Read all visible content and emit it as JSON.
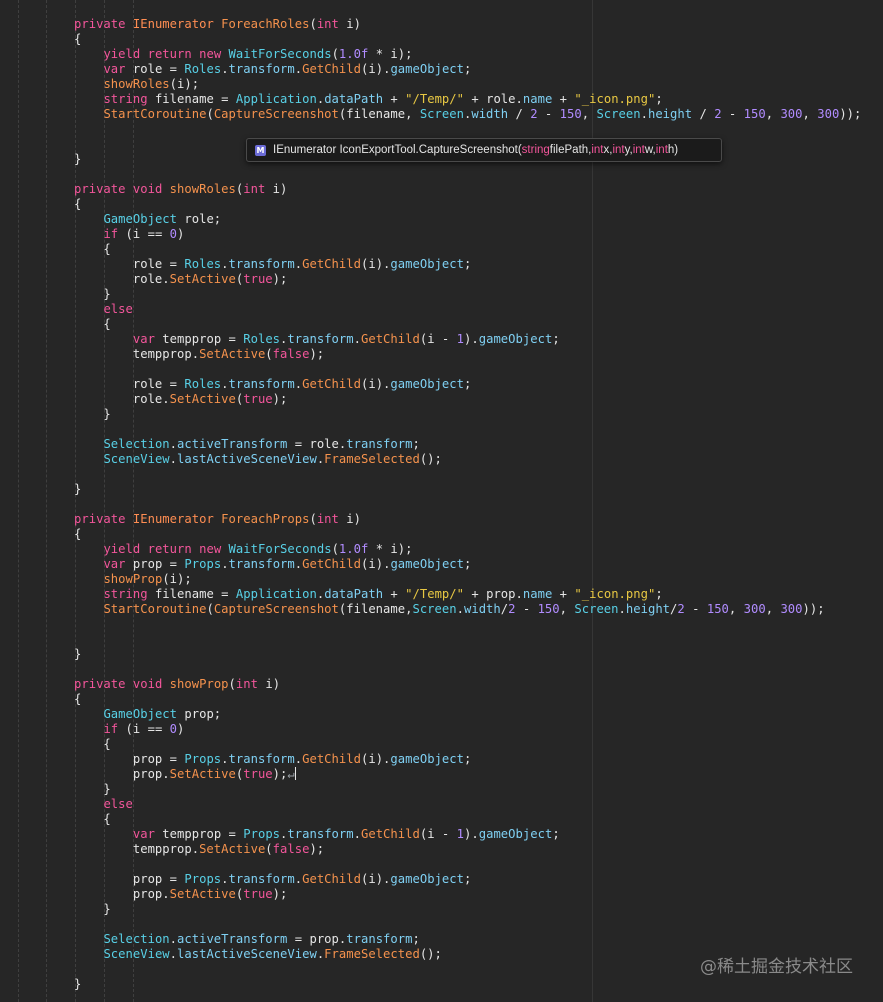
{
  "editor": {
    "language": "csharp",
    "colors": {
      "background": "#262626",
      "keyword": "#f3569b",
      "type": "#ff8d52",
      "string": "#e8c843",
      "method": "#f5924d",
      "member": "#7fd0f3",
      "class": "#58d0e6",
      "number": "#b18cff"
    },
    "lines": [
      "private IEnumerator ForeachRoles(int i)",
      "{",
      "    yield return new WaitForSeconds(1.0f * i);",
      "    var role = Roles.transform.GetChild(i).gameObject;",
      "    showRoles(i);",
      "    string filename = Application.dataPath + \"/Temp/\" + role.name + \"_icon.png\";",
      "    StartCoroutine(CaptureScreenshot(filename, Screen.width / 2 - 150, Screen.height / 2 - 150, 300, 300));",
      "",
      "",
      "}",
      "",
      "private void showRoles(int i)",
      "{",
      "    GameObject role;",
      "    if (i == 0)",
      "    {",
      "        role = Roles.transform.GetChild(i).gameObject;",
      "        role.SetActive(true);",
      "    }",
      "    else",
      "    {",
      "        var tempprop = Roles.transform.GetChild(i - 1).gameObject;",
      "        tempprop.SetActive(false);",
      "",
      "        role = Roles.transform.GetChild(i).gameObject;",
      "        role.SetActive(true);",
      "    }",
      "",
      "    Selection.activeTransform = role.transform;",
      "    SceneView.lastActiveSceneView.FrameSelected();",
      "",
      "}",
      "",
      "private IEnumerator ForeachProps(int i)",
      "{",
      "    yield return new WaitForSeconds(1.0f * i);",
      "    var prop = Props.transform.GetChild(i).gameObject;",
      "    showProp(i);",
      "    string filename = Application.dataPath + \"/Temp/\" + prop.name + \"_icon.png\";",
      "    StartCoroutine(CaptureScreenshot(filename,Screen.width/2 - 150, Screen.height/2 - 150, 300, 300));",
      "",
      "",
      "}",
      "",
      "private void showProp(int i)",
      "{",
      "    GameObject prop;",
      "    if (i == 0)",
      "    {",
      "        prop = Props.transform.GetChild(i).gameObject;",
      "        prop.SetActive(true);↵",
      "    }",
      "    else",
      "    {",
      "        var tempprop = Props.transform.GetChild(i - 1).gameObject;",
      "        tempprop.SetActive(false);",
      "",
      "        prop = Props.transform.GetChild(i).gameObject;",
      "        prop.SetActive(true);",
      "    }",
      "",
      "    Selection.activeTransform = prop.transform;",
      "    SceneView.lastActiveSceneView.FrameSelected();",
      "",
      "}"
    ]
  },
  "tooltip": {
    "icon_letter": "M",
    "icon": "method-icon",
    "return_type": "IEnumerator",
    "method": "IconExportTool.CaptureScreenshot(",
    "p1_type": "string",
    "p1_name": " filePath, ",
    "p2_type": "int",
    "p2_name": " x, ",
    "p3_type": "int",
    "p3_name": " y, ",
    "p4_type": "int",
    "p4_name": " w, ",
    "p5_type": "int",
    "p5_name": " h)"
  },
  "watermark": "@稀土掘金技术社区"
}
